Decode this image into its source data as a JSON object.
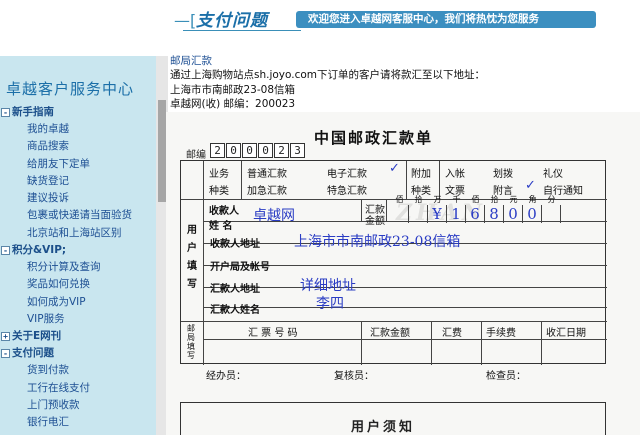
{
  "header": {
    "bracket": "—[",
    "title": "支付问题",
    "welcome": "欢迎您进入卓越网客服中心，我们将热忱为您服务"
  },
  "sidebar": {
    "title": "卓越客户服务中心",
    "groups": [
      {
        "toggle": "-",
        "label": "新手指南",
        "items": [
          "我的卓越",
          "商品搜索",
          "给朋友下定单",
          "缺货登记",
          "建议投诉",
          "包裹或快递请当面验货",
          "北京站和上海站区别"
        ]
      },
      {
        "toggle": "-",
        "label": "积分&VIP;",
        "items": [
          "积分计算及查询",
          "奖品如何兑换",
          "如何成为VIP",
          "VIP服务"
        ]
      },
      {
        "toggle": "+",
        "label": "关于E网刊",
        "items": []
      },
      {
        "toggle": "-",
        "label": "支付问题",
        "items": [
          "货到付款",
          "工行在线支付",
          "上门预收款",
          "银行电汇"
        ]
      }
    ]
  },
  "main": {
    "section_title": "邮局汇款",
    "line1": "通过上海购物站点sh.joyo.com下订单的客户请将款汇至以下地址：",
    "line2": "上海市市南邮政23-08信箱",
    "line3": "卓越网(收) 邮编：200023"
  },
  "form": {
    "title": "中国邮政汇款单",
    "postcode_label": "邮编",
    "postcode_digits": [
      "2",
      "0",
      "0",
      "0",
      "2",
      "3"
    ],
    "business_type_label1": "业务",
    "business_type_label2": "种类",
    "opt_normal": "普通汇款",
    "opt_electronic": "电子汇款",
    "opt_urgent": "加急汇款",
    "opt_special": "特急汇款",
    "addon_label1": "附加",
    "addon_label2": "种类",
    "opt_receipt": "入帐",
    "opt_transfer": "划拨",
    "opt_gift": "礼仪",
    "opt_slip": "文票",
    "opt_message": "附言",
    "opt_notify": "自行通知",
    "check_mark": "✓",
    "side_label": [
      "用",
      "户",
      "填",
      "写"
    ],
    "payee_label": "收款人",
    "name_label": "姓  名",
    "payee_name": "卓越网",
    "amount_label1": "汇款",
    "amount_label2": "金额",
    "amount_units": [
      "佰",
      "拾",
      "万",
      "千",
      "佰",
      "拾",
      "元",
      "角",
      "分"
    ],
    "amount_digits": [
      "",
      "",
      "¥",
      "1",
      "6",
      "8",
      "0",
      "0",
      ""
    ],
    "payee_address_label": "收款人地址",
    "payee_address": "上海市市南邮政23-08信箱",
    "open_bank_label": "开户局及帐号",
    "remitter_address_label": "汇款人地址",
    "remitter_address": "详细地址",
    "remitter_name_label": "汇款人姓名",
    "remitter_name": "李四",
    "post_side_label": [
      "邮",
      "局",
      "填",
      "写"
    ],
    "col_number": "汇  票  号  码",
    "col_amount": "汇款金额",
    "col_fee": "汇费",
    "col_handling": "手续费",
    "col_date": "收汇日期",
    "handler": "经办员：",
    "reviewer": "复核员：",
    "checker": "检查员：",
    "notice_title": "用户须知",
    "watermark": "ZHAN"
  }
}
